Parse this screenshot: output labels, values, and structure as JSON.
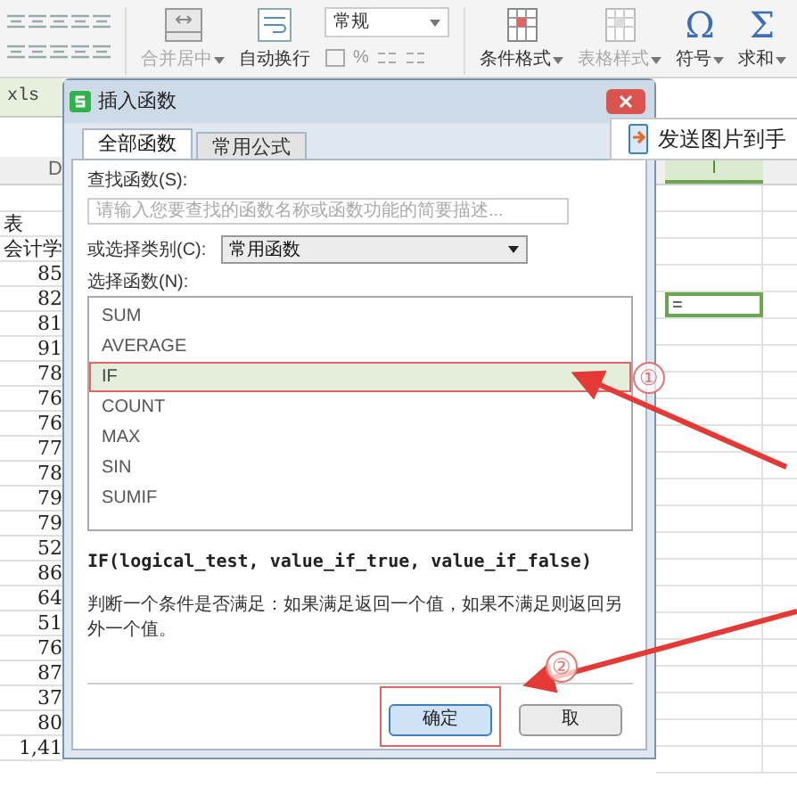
{
  "ribbon": {
    "left_buttons": [
      {
        "label": "合并居中",
        "disabled": true,
        "dropdown": true
      },
      {
        "label": "自动换行",
        "disabled": false,
        "dropdown": false
      }
    ],
    "number_format": {
      "value": "常规",
      "percent": "%"
    },
    "right_buttons": [
      {
        "label": "条件格式",
        "disabled": false,
        "dropdown": true,
        "kind": "grid"
      },
      {
        "label": "表格样式",
        "disabled": true,
        "dropdown": true,
        "kind": "grid"
      },
      {
        "label": "符号",
        "disabled": false,
        "dropdown": true,
        "kind": "glyph",
        "glyph": "Ω"
      },
      {
        "label": "求和",
        "disabled": false,
        "dropdown": true,
        "kind": "glyph",
        "glyph": "Σ"
      }
    ]
  },
  "sheet": {
    "file_tab": "xls",
    "left_column_header": "D",
    "left_cells": [
      "表",
      "会计学",
      "85",
      "82",
      "81",
      "91",
      "78",
      "76",
      "76",
      "77",
      "78",
      "79",
      "79",
      "52",
      "86",
      "64",
      "51",
      "76",
      "87",
      "37",
      "80",
      "1,41"
    ],
    "right_column_header": "I",
    "active_cell": "="
  },
  "tooltip": "发送图片到手",
  "dialog": {
    "title": "插入函数",
    "tabs": [
      {
        "label": "全部函数",
        "selected": true
      },
      {
        "label": "常用公式",
        "selected": false
      }
    ],
    "search_label": "查找函数(S):",
    "search_placeholder": "请输入您要查找的函数名称或函数功能的简要描述...",
    "category_label": "或选择类别(C):",
    "category_value": "常用函数",
    "function_label": "选择函数(N):",
    "functions": [
      {
        "name": "SUM",
        "selected": false
      },
      {
        "name": "AVERAGE",
        "selected": false
      },
      {
        "name": "IF",
        "selected": true
      },
      {
        "name": "COUNT",
        "selected": false
      },
      {
        "name": "MAX",
        "selected": false
      },
      {
        "name": "SIN",
        "selected": false
      },
      {
        "name": "SUMIF",
        "selected": false
      }
    ],
    "signature": "IF(logical_test, value_if_true, value_if_false)",
    "description": "判断一个条件是否满足：如果满足返回一个值，如果不满足则返回另外一个值。",
    "buttons": [
      {
        "label": "确定",
        "highlighted": true
      },
      {
        "label": "取",
        "highlighted": false
      }
    ]
  },
  "annotations": [
    {
      "label": "①"
    },
    {
      "label": "②"
    }
  ]
}
